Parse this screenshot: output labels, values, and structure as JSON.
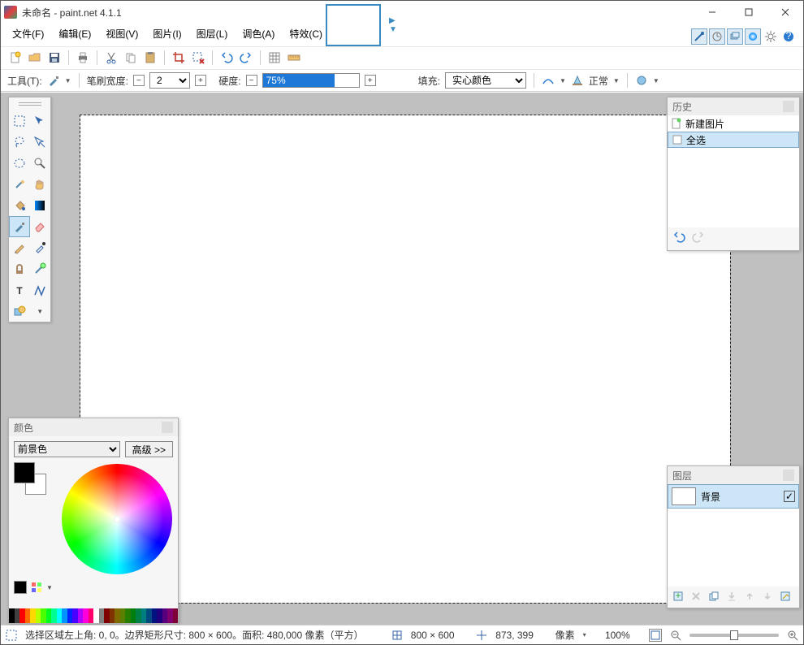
{
  "title": "未命名 - paint.net 4.1.1",
  "menu": {
    "file": "文件(F)",
    "edit": "编辑(E)",
    "view": "视图(V)",
    "image": "图片(I)",
    "layer": "图层(L)",
    "adjust": "调色(A)",
    "effects": "特效(C)"
  },
  "options": {
    "tools_label": "工具(T):",
    "brush_width_label": "笔刷宽度:",
    "brush_width_value": "2",
    "hardness_label": "硬度:",
    "hardness_value": "75%",
    "hardness_pct": 75,
    "fill_label": "填充:",
    "fill_value": "实心颜色",
    "blend_label": "正常"
  },
  "colors": {
    "panel_title": "颜色",
    "mode": "前景色",
    "advanced": "高级 >>",
    "palette": [
      "#000000",
      "#404040",
      "#ff0000",
      "#ff6a00",
      "#ffd800",
      "#b6ff00",
      "#4cff00",
      "#00ff21",
      "#00ff90",
      "#00ffff",
      "#0094ff",
      "#0026ff",
      "#4800ff",
      "#b200ff",
      "#ff00dc",
      "#ff006e",
      "#ffffff",
      "#808080",
      "#7f0000",
      "#7f3300",
      "#7f6a00",
      "#5b7f00",
      "#267f00",
      "#007f0e",
      "#007f46",
      "#007f7f",
      "#004a7f",
      "#00137f",
      "#21007f",
      "#57007f",
      "#7f006e",
      "#7f0037"
    ]
  },
  "history": {
    "panel_title": "历史",
    "items": [
      {
        "icon": "new-image-icon",
        "label": "新建图片"
      },
      {
        "icon": "select-all-icon",
        "label": "全选"
      }
    ],
    "selected_index": 1
  },
  "layers": {
    "panel_title": "图层",
    "items": [
      {
        "name": "背景",
        "visible": true
      }
    ]
  },
  "status": {
    "selection_info": "选择区域左上角: 0, 0。边界矩形尺寸: 800 × 600。面积: 480,000 像素（平方）",
    "size": "800 × 600",
    "cursor": "873, 399",
    "units": "像素",
    "zoom": "100%"
  }
}
